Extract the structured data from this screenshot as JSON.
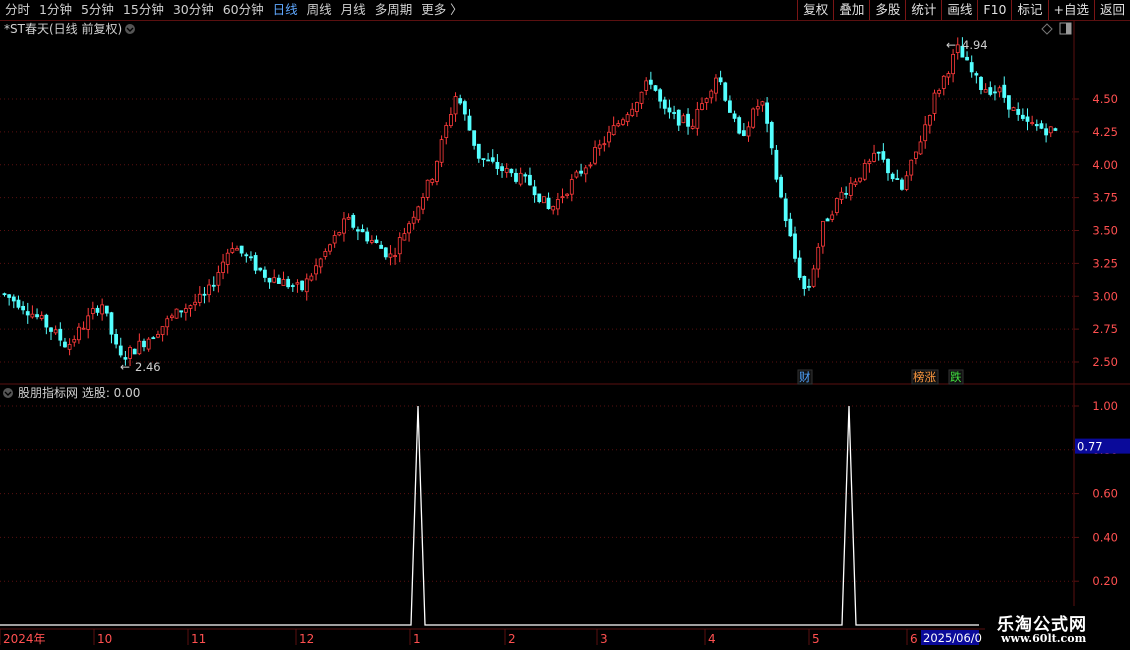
{
  "toolbar": {
    "periods": [
      "分时",
      "1分钟",
      "5分钟",
      "15分钟",
      "30分钟",
      "60分钟",
      "日线",
      "周线",
      "月线",
      "多周期",
      "更多 〉"
    ],
    "active_period": "日线",
    "tools": [
      "复权",
      "叠加",
      "多股",
      "统计",
      "画线",
      "F10",
      "标记",
      "+自选",
      "返回"
    ]
  },
  "main_panel": {
    "title": "*ST春天(日线 前复权)",
    "high_label": "4.94",
    "low_label": "2.46",
    "price_ticks": [
      "4.50",
      "4.25",
      "4.00",
      "3.75",
      "3.50",
      "3.25",
      "3.00",
      "2.75",
      "2.50"
    ],
    "tags": [
      {
        "text": "财",
        "color": "#4fa3ff"
      },
      {
        "text": "榜涨",
        "color": "#ff9a40"
      },
      {
        "text": "跌",
        "color": "#40e040"
      }
    ]
  },
  "indicator_panel": {
    "title": "股朋指标网 选股: 0.00",
    "ticks": [
      "1.00",
      "0.80",
      "0.60",
      "0.40",
      "0.20"
    ],
    "current_value": "0.77"
  },
  "date_axis": [
    "2024年",
    "10",
    "11",
    "12",
    "1",
    "2",
    "3",
    "4",
    "5",
    "6"
  ],
  "date_cursor": "2025/06/0",
  "watermark": {
    "line1": "乐淘公式网",
    "line2": "www.60lt.com"
  },
  "colors": {
    "up": "#ff3b3b",
    "down": "#54ffff",
    "grid": "#5a1010",
    "indicator_line": "#ffffff"
  },
  "chart_data": {
    "type": "candlestick",
    "price_range": [
      2.46,
      4.94
    ],
    "marked_low": 2.46,
    "marked_high": 4.94,
    "indicator": {
      "type": "line",
      "range": [
        0,
        1.0
      ],
      "spikes": [
        {
          "near": "1",
          "value": 1.0
        },
        {
          "near": "5",
          "value": 1.0
        }
      ],
      "baseline": 0.0
    }
  }
}
